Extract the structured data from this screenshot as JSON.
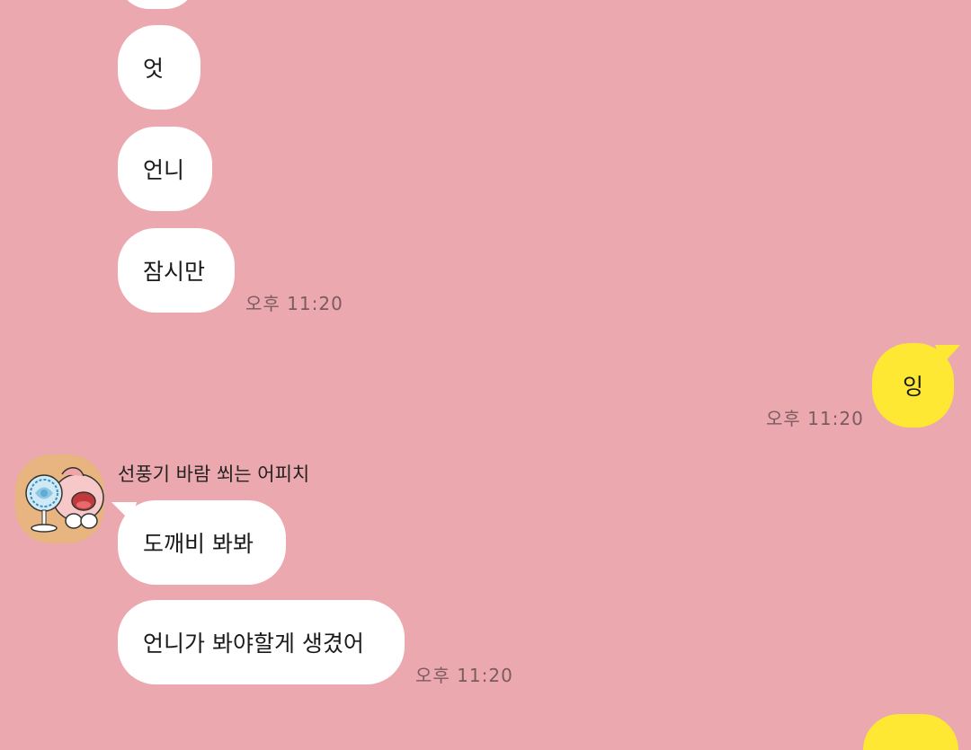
{
  "chat": {
    "messages": [
      {
        "text": ""
      },
      {
        "text": "엇"
      },
      {
        "text": "언니"
      },
      {
        "text": "잠시만",
        "time": "오후 11:20"
      },
      {
        "text": "잉",
        "time": "오후 11:20"
      },
      {
        "sender": "선풍기 바람 쐬는 어피치"
      },
      {
        "text": "도깨비 봐봐"
      },
      {
        "text": "언니가 봐야할게 생겼어",
        "time": "오후 11:20"
      }
    ]
  },
  "colors": {
    "background": "#eba8ae",
    "incoming_bubble": "#ffffff",
    "outgoing_bubble": "#fee833"
  },
  "icons": {
    "avatar": "apeach-fan-avatar-icon"
  }
}
